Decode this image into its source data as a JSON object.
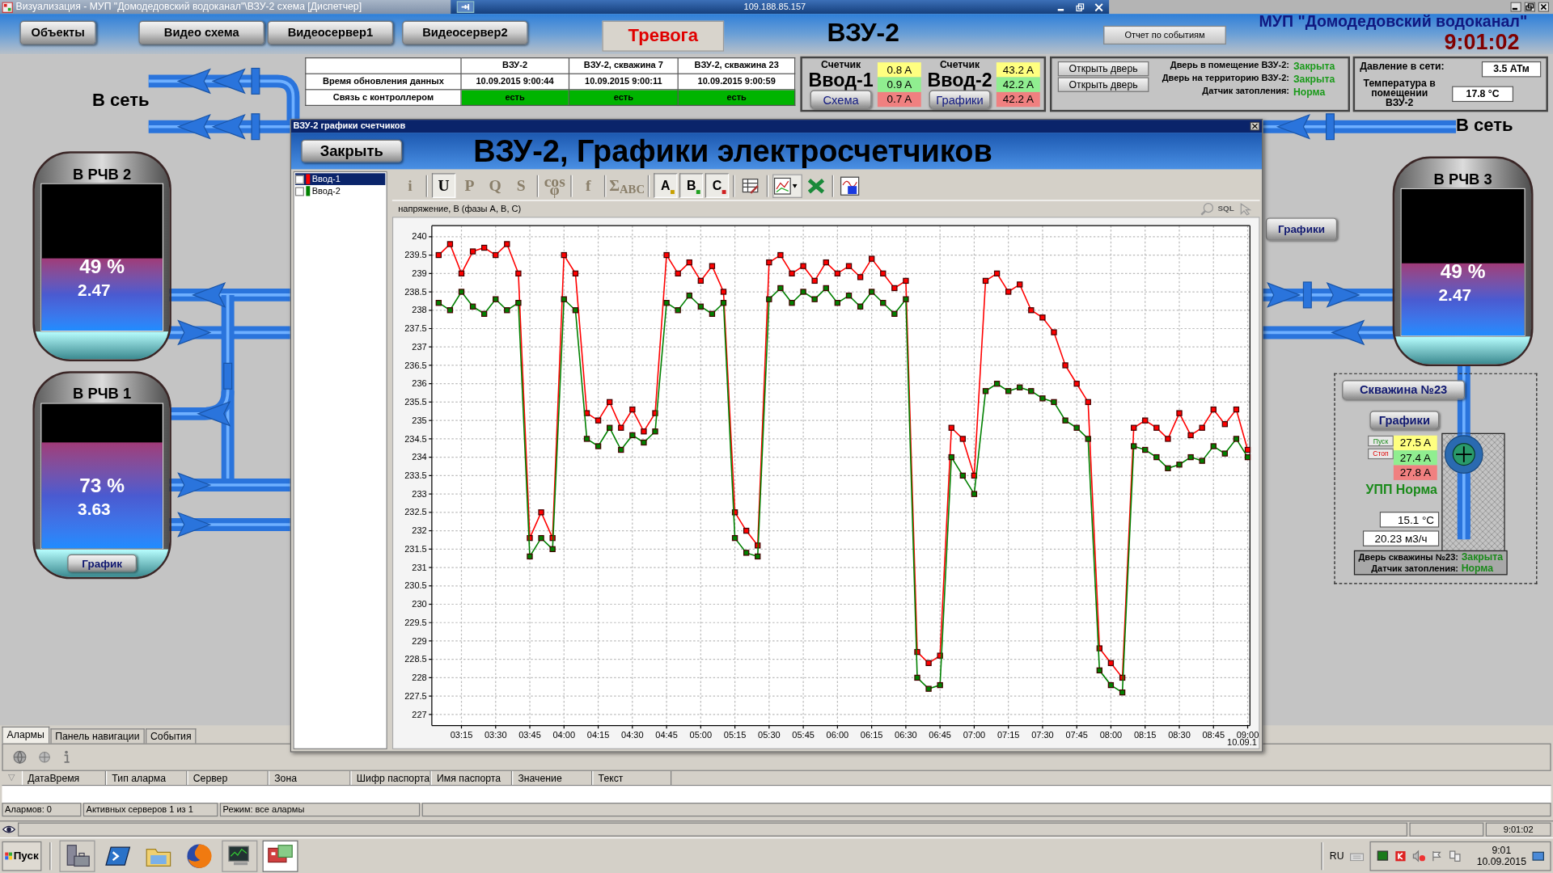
{
  "window": {
    "title": "Визуализация - МУП \"Домодедовский водоканал\"\\ВЗУ-2 схема [Диспетчер]",
    "address": "109.188.85.157"
  },
  "nav_buttons": [
    "Объекты",
    "Видео схема",
    "Видеосервер1",
    "Видеосервер2"
  ],
  "alarm_button": "Тревога",
  "station_title": "ВЗУ-2",
  "report_button": "Отчет по событиям",
  "org_name": "МУП \"Домодедовский водоканал\"",
  "clock": "9:01:02",
  "status_table": {
    "columns": [
      "ВЗУ-2",
      "ВЗУ-2, скважина 7",
      "ВЗУ-2, скважина 23"
    ],
    "rows": [
      {
        "kind": "text",
        "label": "Время обновления данных",
        "cells": [
          "10.09.2015 9:00:44",
          "10.09.2015 9:00:11",
          "10.09.2015 9:00:59"
        ]
      },
      {
        "kind": "status",
        "label": "Связь с контроллером",
        "cells": [
          "есть",
          "есть",
          "есть"
        ]
      }
    ]
  },
  "meters": [
    {
      "caption": "Счетчик",
      "name": "Ввод-1",
      "button": "Схема",
      "currents": [
        {
          "value": "0.8 A",
          "color": "#ffff80"
        },
        {
          "value": "0.9 A",
          "color": "#90ee90"
        },
        {
          "value": "0.7 A",
          "color": "#f08080"
        }
      ]
    },
    {
      "caption": "Счетчик",
      "name": "Ввод-2",
      "button": "Графики",
      "currents": [
        {
          "value": "43.2 A",
          "color": "#ffff80"
        },
        {
          "value": "42.2 A",
          "color": "#90ee90"
        },
        {
          "value": "42.2 A",
          "color": "#f08080"
        }
      ]
    }
  ],
  "doors": {
    "buttons": [
      "Открыть дверь",
      "Открыть дверь"
    ],
    "sensors": [
      {
        "label": "Дверь в помещение ВЗУ-2:",
        "value": "Закрыта"
      },
      {
        "label": "Дверь на территорию ВЗУ-2:",
        "value": "Закрыта"
      },
      {
        "label": "Датчик затопления:",
        "value": "Норма"
      }
    ]
  },
  "readings": [
    {
      "label": "Давление в сети:",
      "value": "3.5 АТм"
    },
    {
      "label": "Температура в помещении ВЗУ-2",
      "value": "17.8 °C"
    }
  ],
  "pipe_labels": [
    "В сеть",
    "В сеть"
  ],
  "tanks": [
    {
      "name": "В РЧВ 2",
      "percent": "49 %",
      "volume": "2.47",
      "level": 0.49
    },
    {
      "name": "В РЧВ 1",
      "percent": "73 %",
      "volume": "3.63",
      "level": 0.73,
      "button": "График"
    },
    {
      "name": "В РЧВ 3",
      "percent": "49 %",
      "volume": "2.47",
      "level": 0.49
    }
  ],
  "graphs_button": "Графики",
  "well": {
    "title": "Скважина №23",
    "graphs_button": "Графики",
    "start_button": "Пуск",
    "stop_button": "Стоп",
    "currents": [
      {
        "value": "27.5 A",
        "color": "#ffff80"
      },
      {
        "value": "27.4 A",
        "color": "#90ee90"
      },
      {
        "value": "27.8 A",
        "color": "#f08080"
      }
    ],
    "status": "УПП Норма",
    "temperature": "15.1 °C",
    "flow": "20.23 м3/ч",
    "door_label": "Дверь скважины №23:",
    "door_value": "Закрыта",
    "flood_label": "Датчик затопления:",
    "flood_value": "Норма"
  },
  "dialog": {
    "title": "ВЗУ-2 графики счетчиков",
    "close_button": "Закрыть",
    "heading": "ВЗУ-2, Графики электросчетчиков",
    "legend": [
      {
        "checked": false,
        "selected": true
      },
      {
        "checked": false,
        "selected": false
      }
    ],
    "toolbar": [
      {
        "label": "i",
        "selected": false
      },
      {
        "label": "U",
        "selected": true
      },
      {
        "label": "P",
        "selected": false
      },
      {
        "label": "Q",
        "selected": false
      },
      {
        "label": "S",
        "selected": false
      },
      {
        "label": "cos φ",
        "selected": false
      },
      {
        "label": "f",
        "selected": false
      },
      {
        "label": "Σ$_{ABC}$",
        "selected": false
      },
      {
        "label": "A",
        "selected": true,
        "color": "#c8a000"
      },
      {
        "label": "B",
        "selected": true,
        "color": "#20a020"
      },
      {
        "label": "C",
        "selected": true,
        "color": "#d02020"
      }
    ],
    "sql_label": "SQL",
    "chart_caption": "напряжение, В (фазы A, B, C)",
    "date_label": "10.09.1",
    "chart_data": {
      "type": "line",
      "grid": true,
      "x": [
        185,
        190,
        195,
        200,
        205,
        210,
        215,
        220,
        225,
        230,
        235,
        240,
        245,
        250,
        255,
        260,
        265,
        270,
        275,
        280,
        285,
        290,
        295,
        300,
        305,
        310,
        315,
        320,
        325,
        330,
        335,
        340,
        345,
        350,
        355,
        360,
        365,
        370,
        375,
        380,
        385,
        390,
        395,
        400,
        405,
        410,
        415,
        420,
        425,
        430,
        435,
        440,
        445,
        450,
        455,
        460,
        465,
        470,
        475,
        480,
        485,
        490,
        495,
        500,
        505,
        510,
        515,
        520,
        525,
        530,
        535,
        540
      ],
      "series": [
        {
          "name": "Ввод-1",
          "color": "#ff0000",
          "marker": "square",
          "values": [
            239.5,
            239.8,
            239,
            239.6,
            239.7,
            239.5,
            239.8,
            239,
            231.8,
            232.5,
            231.8,
            239.5,
            239,
            235.2,
            235,
            235.5,
            234.8,
            235.3,
            234.7,
            235.2,
            239.5,
            239,
            239.3,
            238.8,
            239.2,
            238.5,
            232.5,
            232,
            231.6,
            239.3,
            239.5,
            239,
            239.2,
            238.8,
            239.3,
            239,
            239.2,
            238.9,
            239.4,
            239,
            238.6,
            238.8,
            228.7,
            228.4,
            228.6,
            234.8,
            234.5,
            233.5,
            238.8,
            239,
            238.5,
            238.7,
            238,
            237.8,
            237.4,
            236.5,
            236,
            235.5,
            228.8,
            228.4,
            228,
            234.8,
            235,
            234.8,
            234.5,
            235.2,
            234.6,
            234.8,
            235.3,
            234.9,
            235.3,
            234.2
          ]
        },
        {
          "name": "Ввод-2",
          "color": "#008000",
          "marker": "square",
          "values": [
            238.2,
            238,
            238.5,
            238.1,
            237.9,
            238.3,
            238,
            238.2,
            231.3,
            231.8,
            231.5,
            238.3,
            238,
            234.5,
            234.3,
            234.8,
            234.2,
            234.6,
            234.4,
            234.7,
            238.2,
            238,
            238.4,
            238.1,
            237.9,
            238.2,
            231.8,
            231.4,
            231.3,
            238.3,
            238.6,
            238.2,
            238.5,
            238.3,
            238.6,
            238.2,
            238.4,
            238.1,
            238.5,
            238.2,
            237.9,
            238.3,
            228,
            227.7,
            227.8,
            234,
            233.5,
            233,
            235.8,
            236,
            235.8,
            235.9,
            235.8,
            235.6,
            235.5,
            235,
            234.8,
            234.5,
            228.2,
            227.8,
            227.6,
            234.3,
            234.2,
            234,
            233.7,
            233.8,
            234,
            233.9,
            234.3,
            234.1,
            234.5,
            234
          ]
        }
      ],
      "xlim": [
        182,
        541
      ],
      "ylim": [
        226.7,
        240.3
      ],
      "xticks": [
        {
          "value": 195,
          "label": "03:15"
        },
        {
          "value": 210,
          "label": "03:30"
        },
        {
          "value": 225,
          "label": "03:45"
        },
        {
          "value": 240,
          "label": "04:00"
        },
        {
          "value": 255,
          "label": "04:15"
        },
        {
          "value": 270,
          "label": "04:30"
        },
        {
          "value": 285,
          "label": "04:45"
        },
        {
          "value": 300,
          "label": "05:00"
        },
        {
          "value": 315,
          "label": "05:15"
        },
        {
          "value": 330,
          "label": "05:30"
        },
        {
          "value": 345,
          "label": "05:45"
        },
        {
          "value": 360,
          "label": "06:00"
        },
        {
          "value": 375,
          "label": "06:15"
        },
        {
          "value": 390,
          "label": "06:30"
        },
        {
          "value": 405,
          "label": "06:45"
        },
        {
          "value": 420,
          "label": "07:00"
        },
        {
          "value": 435,
          "label": "07:15"
        },
        {
          "value": 450,
          "label": "07:30"
        },
        {
          "value": 465,
          "label": "07:45"
        },
        {
          "value": 480,
          "label": "08:00"
        },
        {
          "value": 495,
          "label": "08:15"
        },
        {
          "value": 510,
          "label": "08:30"
        },
        {
          "value": 525,
          "label": "08:45"
        },
        {
          "value": 540,
          "label": "09:00"
        }
      ],
      "yticks": [
        227,
        227.5,
        228,
        228.5,
        229,
        229.5,
        230,
        230.5,
        231,
        231.5,
        232,
        232.5,
        233,
        233.5,
        234,
        234.5,
        235,
        235.5,
        236,
        236.5,
        237,
        237.5,
        238,
        238.5,
        239,
        239.5,
        240
      ]
    }
  },
  "bottom_panel": {
    "tabs": [
      {
        "label": "Алармы",
        "selected": true
      },
      {
        "label": "Панель навигации",
        "selected": false
      },
      {
        "label": "События",
        "selected": false
      }
    ],
    "filter_icon": "▽",
    "columns": [
      "ДатаВремя",
      "Тип аларма",
      "Сервер",
      "Зона",
      "Шифр паспорта",
      "Имя паспорта",
      "Значение",
      "Текст"
    ],
    "status": [
      "Алармов: 0",
      "Активных серверов 1 из 1",
      "Режим: все алармы"
    ]
  },
  "status_bar": {
    "time": "9:01:02"
  },
  "taskbar": {
    "start": "Пуск",
    "language": "RU",
    "time": "9:01",
    "date": "10.09.2015"
  }
}
